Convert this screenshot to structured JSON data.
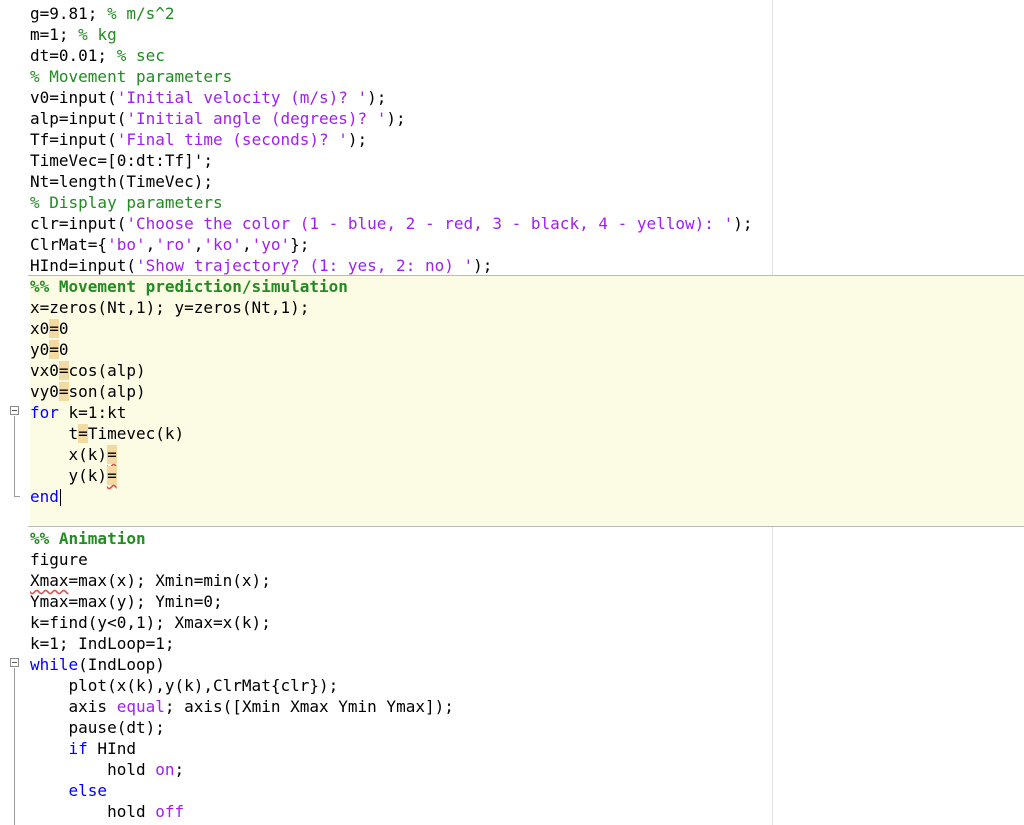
{
  "editor": {
    "lines": {
      "l1a": "g=9.81; ",
      "l1b": "% m/s^2",
      "l2a": "m=1; ",
      "l2b": "% kg",
      "l3a": "dt=0.01; ",
      "l3b": "% sec",
      "l4": "% Movement parameters",
      "l5a": "v0=input(",
      "l5b": "'Initial velocity (m/s)? '",
      "l5c": ");",
      "l6a": "alp=input(",
      "l6b": "'Initial angle (degrees)? '",
      "l6c": ");",
      "l7a": "Tf=input(",
      "l7b": "'Final time (seconds)? '",
      "l7c": ");",
      "l8": "TimeVec=[0:dt:Tf]';",
      "l9": "Nt=length(TimeVec);",
      "l10": "% Display parameters",
      "l11a": "clr=input(",
      "l11b": "'Choose the color (1 - blue, 2 - red, 3 - black, 4 - yellow): '",
      "l11c": ");",
      "l12a": "ClrMat={",
      "l12b": "'bo'",
      "l12c": ",",
      "l12d": "'ro'",
      "l12e": ",",
      "l12f": "'ko'",
      "l12g": ",",
      "l12h": "'yo'",
      "l12i": "};",
      "l13a": "HInd=input(",
      "l13b": "'Show trajectory? (1: yes, 2: no) '",
      "l13c": ");",
      "l14": "%% Movement prediction/simulation",
      "l15": "x=zeros(Nt,1); y=zeros(Nt,1);",
      "l16a": "x0",
      "l16b": "=",
      "l16c": "0",
      "l17a": "y0",
      "l17b": "=",
      "l17c": "0",
      "l18a": "vx0",
      "l18b": "=",
      "l18c": "cos(alp)",
      "l19a": "vy0",
      "l19b": "=",
      "l19c": "son(alp)",
      "l20a": "for",
      "l20b": " k=1:kt",
      "l21a": "    t",
      "l21b": "=",
      "l21c": "Timevec(k)",
      "l22a": "    x(k)",
      "l22b": "=",
      "l23a": "    y(k)",
      "l23b": "=",
      "l24": "end",
      "l25": "%% Animation",
      "l26": "figure",
      "l27a": "Xmax",
      "l27b": "=max(x); Xmin=min(x);",
      "l28": "Ymax=max(y); Ymin=0;",
      "l29": "k=find(y<0,1); Xmax=x(k);",
      "l30": "k=1; IndLoop=1;",
      "l31a": "while",
      "l31b": "(IndLoop)",
      "l32": "    plot(x(k),y(k),ClrMat{clr});",
      "l33a": "    axis ",
      "l33b": "equal",
      "l33c": "; axis([Xmin Xmax Ymin Ymax]);",
      "l34": "    pause(dt);",
      "l35a": "    ",
      "l35b": "if",
      "l35c": " HInd",
      "l36a": "        hold ",
      "l36b": "on",
      "l36c": ";",
      "l37a": "    ",
      "l37b": "else",
      "l38a": "        hold ",
      "l38b": "off"
    }
  },
  "colors": {
    "keyword": "#0000ff",
    "string": "#a020f0",
    "comment": "#228b22",
    "section_background": "#fcfbe3",
    "text": "#000000"
  }
}
